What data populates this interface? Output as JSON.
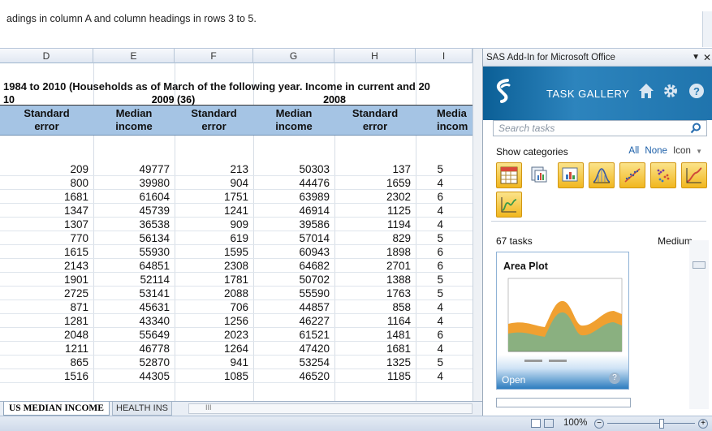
{
  "formula_bar": {
    "text": "adings in column A and column headings in rows 3 to 5."
  },
  "columns": [
    "D",
    "E",
    "F",
    "G",
    "H",
    "I"
  ],
  "sheet": {
    "title_line": "1984 to 2010 (Households as of March of the following year.  Income in current and 20",
    "year_labels": [
      "10",
      "2009 (36)",
      "2008"
    ],
    "headers": [
      [
        "Standard",
        "error"
      ],
      [
        "Median",
        "income"
      ],
      [
        "Standard",
        "error"
      ],
      [
        "Median",
        "income"
      ],
      [
        "Standard",
        "error"
      ],
      [
        "Media",
        "incom"
      ]
    ],
    "rows": [
      [
        "209",
        "49777",
        "213",
        "50303",
        "137",
        "5"
      ],
      [
        "800",
        "39980",
        "904",
        "44476",
        "1659",
        "4"
      ],
      [
        "1681",
        "61604",
        "1751",
        "63989",
        "2302",
        "6"
      ],
      [
        "1347",
        "45739",
        "1241",
        "46914",
        "1125",
        "4"
      ],
      [
        "1307",
        "36538",
        "909",
        "39586",
        "1194",
        "4"
      ],
      [
        "770",
        "56134",
        "619",
        "57014",
        "829",
        "5"
      ],
      [
        "1615",
        "55930",
        "1595",
        "60943",
        "1898",
        "6"
      ],
      [
        "2143",
        "64851",
        "2308",
        "64682",
        "2701",
        "6"
      ],
      [
        "1901",
        "52114",
        "1781",
        "50702",
        "1388",
        "5"
      ],
      [
        "2725",
        "53141",
        "2088",
        "55590",
        "1763",
        "5"
      ],
      [
        "871",
        "45631",
        "706",
        "44857",
        "858",
        "4"
      ],
      [
        "1281",
        "43340",
        "1256",
        "46227",
        "1164",
        "4"
      ],
      [
        "2048",
        "55649",
        "2023",
        "61521",
        "1481",
        "6"
      ],
      [
        "1211",
        "46778",
        "1264",
        "47420",
        "1681",
        "4"
      ],
      [
        "865",
        "52870",
        "941",
        "53254",
        "1325",
        "5"
      ],
      [
        "1516",
        "44305",
        "1085",
        "46520",
        "1185",
        "4"
      ]
    ]
  },
  "tabs": {
    "active": "US MEDIAN INCOME",
    "other": "HEALTH INS",
    "scroll_mark": "III"
  },
  "status": {
    "zoom": "100%"
  },
  "sas_panel": {
    "title": "SAS Add-In for Microsoft Office",
    "gallery_label": "TASK GALLERY",
    "search_placeholder": "Search tasks",
    "show_categories": "Show categories",
    "link_all": "All",
    "link_none": "None",
    "link_icon": "Icon",
    "tasks_count": "67 tasks",
    "size_option": "Medium",
    "tile_title": "Area Plot",
    "tile_open": "Open",
    "help_glyph": "?"
  },
  "colors": {
    "header_fill": "#a5c4e4",
    "sas_blue": "#1f74ad",
    "category_gold": "#f1b71f",
    "area_orange": "#f0a030",
    "area_green": "#8ab080"
  }
}
